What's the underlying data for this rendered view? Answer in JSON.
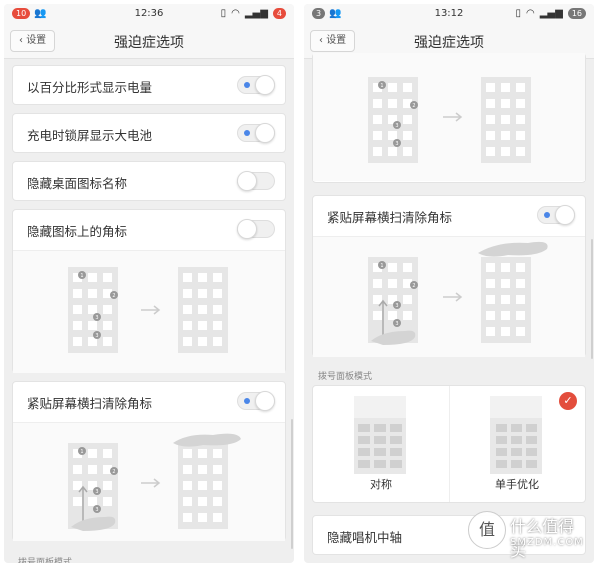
{
  "left": {
    "status": {
      "time": "12:36",
      "notif_badge": "10",
      "battery_badge": "4"
    },
    "header": {
      "back_label": "设置",
      "title": "强迫症选项"
    },
    "rows": [
      {
        "label": "以百分比形式显示电量",
        "on": true
      },
      {
        "label": "充电时锁屏显示大电池",
        "on": true
      },
      {
        "label": "隐藏桌面图标名称",
        "on": false
      },
      {
        "label": "隐藏图标上的角标",
        "on": false
      },
      {
        "label": "紧贴屏幕横扫清除角标",
        "on": true
      }
    ],
    "section_label": "拨号面板模式",
    "diagram_badges": [
      "1",
      "2",
      "3",
      "3"
    ]
  },
  "right": {
    "status": {
      "time": "13:12",
      "notif_badge": "3",
      "battery_badge": "16"
    },
    "header": {
      "back_label": "设置",
      "title": "强迫症选项"
    },
    "swipe_row": {
      "label": "紧贴屏幕横扫清除角标",
      "on": true
    },
    "section_label": "拨号面板模式",
    "dial_modes": [
      {
        "label": "对称",
        "selected": false
      },
      {
        "label": "单手优化",
        "selected": true
      }
    ],
    "bottom_row": {
      "label": "隐藏唱机中轴"
    },
    "check_glyph": "✓"
  },
  "watermark": {
    "glyph": "值",
    "line1": "什么值得买",
    "line2": "SMZDM.COM"
  }
}
